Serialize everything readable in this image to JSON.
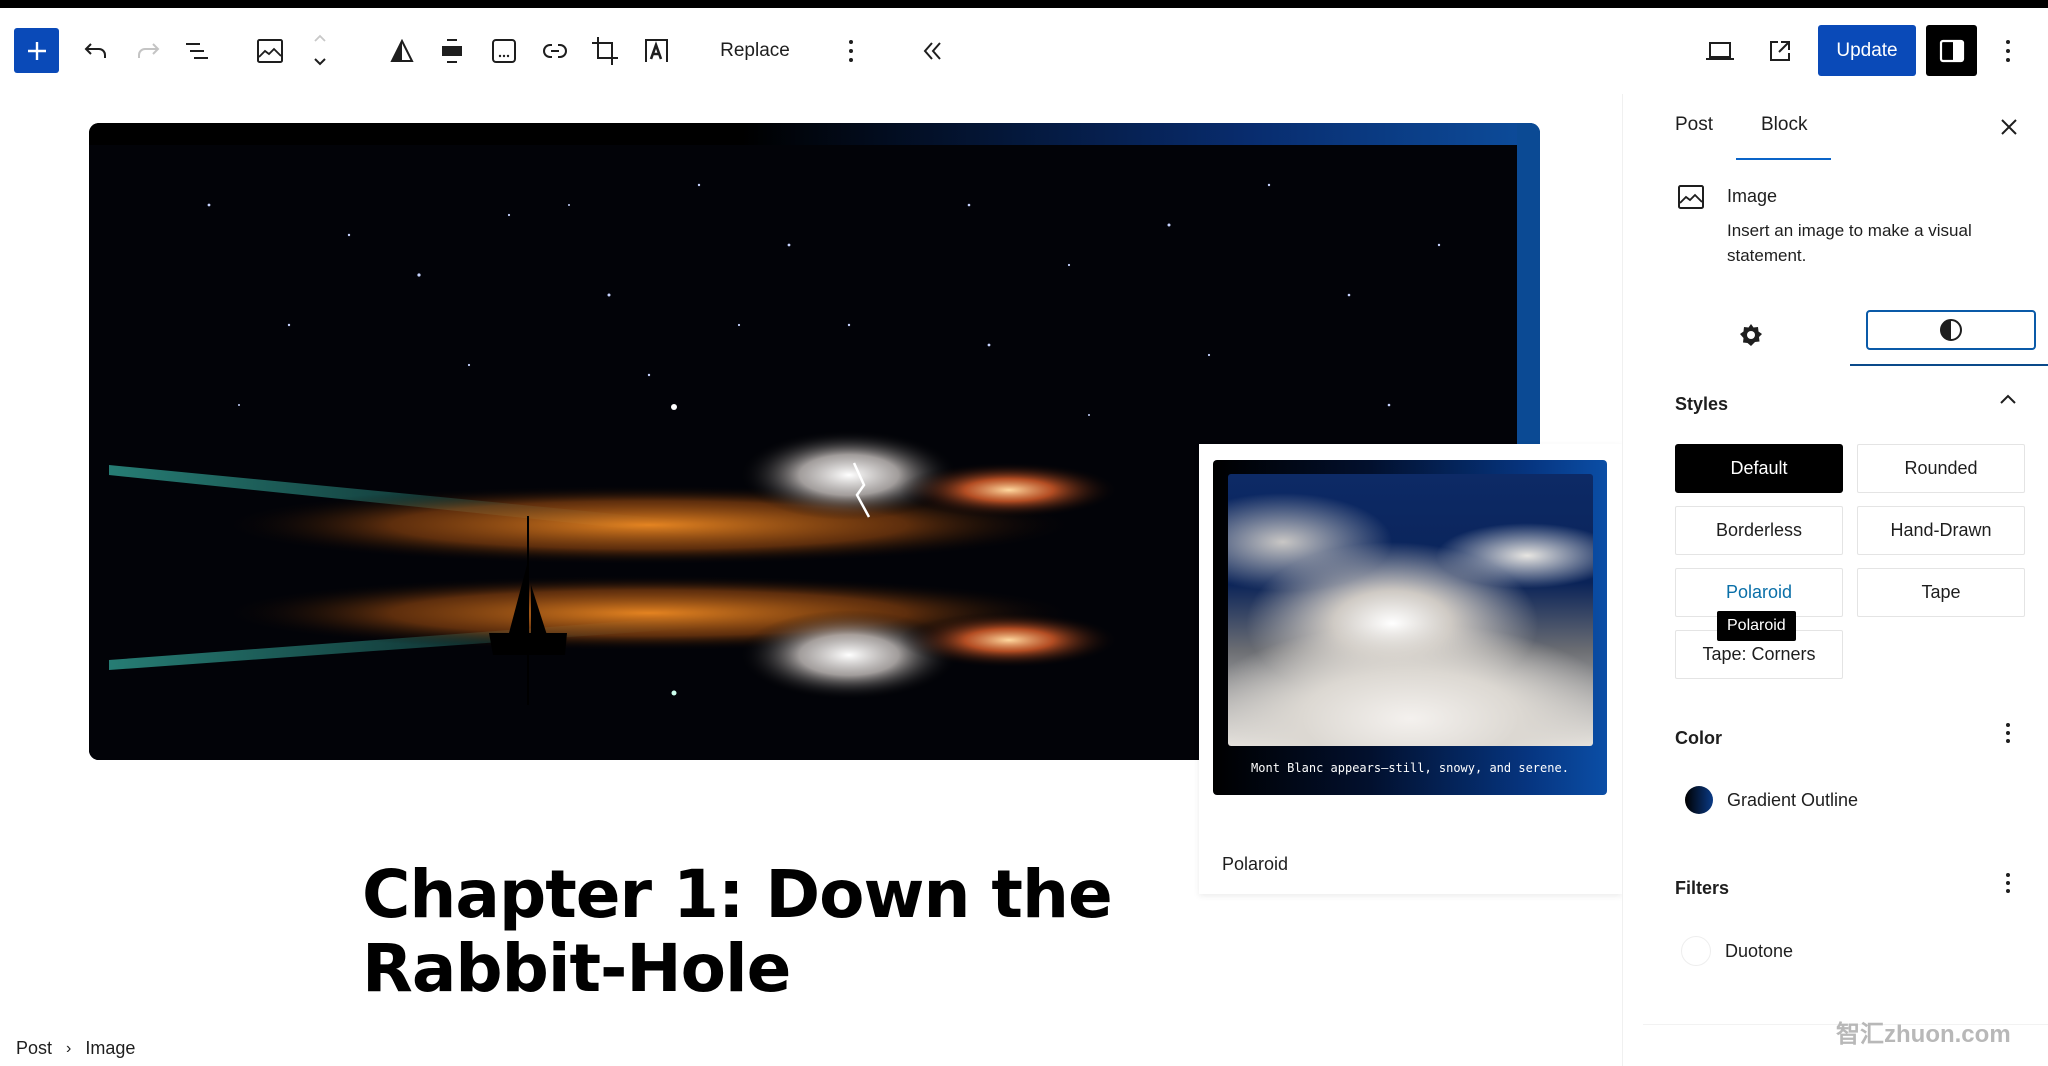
{
  "toolbar": {
    "add_block_label": "+",
    "replace_label": "Replace",
    "update_label": "Update",
    "icons": [
      "plus-icon",
      "undo-icon",
      "redo-icon",
      "list-view-icon",
      "image-icon",
      "move-up-down-icon",
      "duotone-icon",
      "align-icon",
      "caption-icon",
      "link-icon",
      "crop-icon",
      "text-overlay-icon",
      "more-options-icon",
      "collapse-icon",
      "preview-device-icon",
      "view-post-icon",
      "settings-sidebar-icon",
      "options-icon"
    ]
  },
  "canvas": {
    "heading": "Chapter 1: Down the Rabbit-Hole",
    "main_image_description": "Sailboat silhouette under a starry sky with lightning clouds reflected on water"
  },
  "style_preview": {
    "caption": "Mont Blanc appears—still, snowy, and serene.",
    "label": "Polaroid"
  },
  "breadcrumb": {
    "items": [
      "Post",
      "Image"
    ],
    "separator": "›"
  },
  "sidebar": {
    "tabs": [
      {
        "label": "Post",
        "active": false
      },
      {
        "label": "Block",
        "active": true
      }
    ],
    "block": {
      "title": "Image",
      "description": "Insert an image to make a visual statement."
    },
    "subtabs": [
      {
        "name": "settings",
        "active": false
      },
      {
        "name": "styles",
        "active": true
      }
    ],
    "styles": {
      "title": "Styles",
      "options": [
        {
          "label": "Default",
          "state": "active"
        },
        {
          "label": "Rounded",
          "state": ""
        },
        {
          "label": "Borderless",
          "state": ""
        },
        {
          "label": "Hand-Drawn",
          "state": ""
        },
        {
          "label": "Polaroid",
          "state": "hover"
        },
        {
          "label": "Tape",
          "state": ""
        },
        {
          "label": "Tape: Corners",
          "state": ""
        }
      ],
      "tooltip": "Polaroid"
    },
    "color": {
      "title": "Color",
      "item_label": "Gradient Outline",
      "swatch_colors": [
        "#000000",
        "#0a3a86"
      ]
    },
    "filters": {
      "title": "Filters",
      "item_label": "Duotone"
    }
  },
  "colors": {
    "accent": "#0a4ab8",
    "tab_underline": "#0a64c8",
    "hover_text": "#0a6fa8"
  },
  "watermark": "智汇zhuon.com"
}
